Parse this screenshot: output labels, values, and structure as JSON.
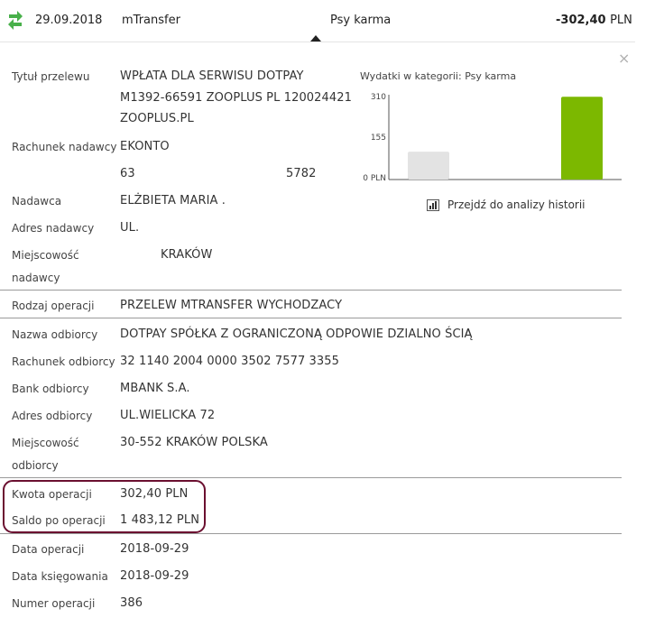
{
  "header": {
    "date": "29.09.2018",
    "type": "mTransfer",
    "category": "Psy karma",
    "amount": "-302,40",
    "currency": "PLN",
    "icon": "transfer-arrows-icon"
  },
  "details": {
    "tytul_label": "Tytuł przelewu",
    "tytul_line1": "WPŁATA DLA SERWISU DOTPAY",
    "tytul_line2": "M1392-66591 ZOOPLUS PL 120024421",
    "tytul_line3": "ZOOPLUS.PL",
    "rachunek_nadawcy_label": "Rachunek nadawcy",
    "rachunek_nadawcy_line1": "EKONTO",
    "rachunek_nadawcy_part1": "63",
    "rachunek_nadawcy_part2": "5782",
    "nadawca_label": "Nadawca",
    "nadawca_value": "ELŻBIETA MARIA .",
    "adres_nadawcy_label": "Adres nadawcy",
    "adres_nadawcy_value": "UL.",
    "miejscowosc_nadawcy_label1": "Miejscowość",
    "miejscowosc_nadawcy_label2": "nadawcy",
    "miejscowosc_nadawcy_value": "KRAKÓW",
    "rodzaj_label": "Rodzaj operacji",
    "rodzaj_value": "PRZELEW MTRANSFER WYCHODZACY",
    "nazwa_odbiorcy_label": "Nazwa odbiorcy",
    "nazwa_odbiorcy_value": "DOTPAY SPÓŁKA Z OGRANICZONĄ ODPOWIE DZIALNO ŚCIĄ",
    "rachunek_odbiorcy_label": "Rachunek odbiorcy",
    "rachunek_odbiorcy_value": "32 1140 2004 0000 3502 7577 3355",
    "bank_odbiorcy_label": "Bank odbiorcy",
    "bank_odbiorcy_value": "MBANK S.A.",
    "adres_odbiorcy_label": "Adres odbiorcy",
    "adres_odbiorcy_value": "UL.WIELICKA 72",
    "miejscowosc_odbiorcy_label1": "Miejscowość",
    "miejscowosc_odbiorcy_label2": "odbiorcy",
    "miejscowosc_odbiorcy_value": "30-552 KRAKÓW POLSKA",
    "kwota_label": "Kwota operacji",
    "kwota_value": "302,40 PLN",
    "saldo_label": "Saldo po operacji",
    "saldo_value": "1 483,12 PLN",
    "data_operacji_label": "Data operacji",
    "data_operacji_value": "2018-09-29",
    "data_ksiegowania_label": "Data księgowania",
    "data_ksiegowania_value": "2018-09-29",
    "numer_label": "Numer operacji",
    "numer_value": "386"
  },
  "chart": {
    "title": "Wydatki w kategorii:  Psy karma",
    "history_link": "Przejdź do analizy historii",
    "colors": {
      "previous": "#e3e3e3",
      "current": "#7cb800",
      "highlight_border": "#6b1030",
      "accent_icon": "#48b04a"
    }
  },
  "chart_data": {
    "type": "bar",
    "categories": [
      "",
      ""
    ],
    "values": [
      102,
      302.4
    ],
    "yticks": [
      "0 PLN",
      "155",
      "310"
    ],
    "ylim": [
      0,
      310
    ],
    "grid": false
  }
}
